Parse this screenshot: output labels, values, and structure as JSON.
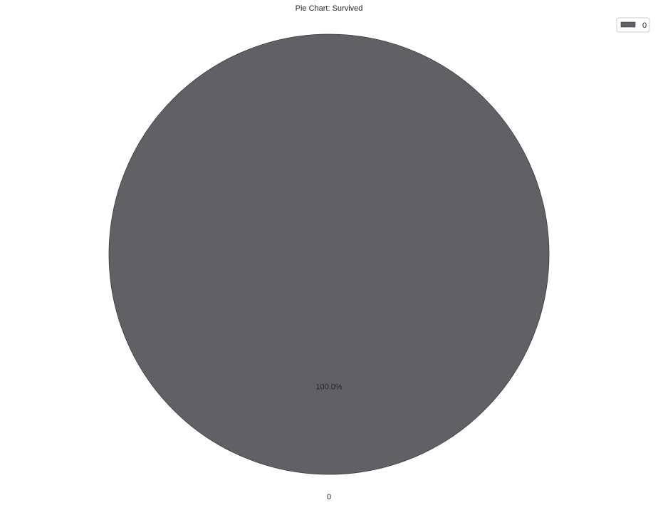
{
  "chart_data": {
    "type": "pie",
    "title": "Pie Chart: Survived",
    "slices": [
      {
        "label": "0",
        "value": 100.0,
        "pct_label": "100.0%",
        "color": "#606065"
      }
    ],
    "legend": {
      "placement": "top-right",
      "entries": [
        "0"
      ]
    }
  }
}
